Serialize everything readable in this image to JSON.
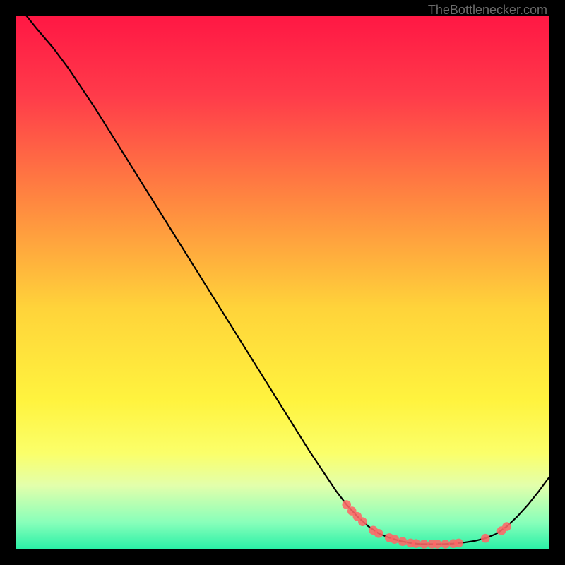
{
  "attribution": "TheBottlenecker.com",
  "chart_data": {
    "type": "line",
    "title": "",
    "xlabel": "",
    "ylabel": "",
    "xlim": [
      0,
      100
    ],
    "ylim": [
      0,
      100
    ],
    "gradient_stops": [
      {
        "offset": 0.0,
        "color": "#ff1744"
      },
      {
        "offset": 0.15,
        "color": "#ff3b4a"
      },
      {
        "offset": 0.35,
        "color": "#ff8840"
      },
      {
        "offset": 0.55,
        "color": "#ffd43a"
      },
      {
        "offset": 0.72,
        "color": "#fff33e"
      },
      {
        "offset": 0.82,
        "color": "#fbff6a"
      },
      {
        "offset": 0.88,
        "color": "#e3ffab"
      },
      {
        "offset": 0.95,
        "color": "#87ffba"
      },
      {
        "offset": 1.0,
        "color": "#28f0a6"
      }
    ],
    "series": [
      {
        "name": "bottleneck-curve",
        "color": "#000000",
        "points": [
          {
            "x": 2.0,
            "y": 100.0
          },
          {
            "x": 4.0,
            "y": 97.5
          },
          {
            "x": 7.0,
            "y": 94.0
          },
          {
            "x": 10.0,
            "y": 90.0
          },
          {
            "x": 15.0,
            "y": 82.5
          },
          {
            "x": 20.0,
            "y": 74.5
          },
          {
            "x": 25.0,
            "y": 66.5
          },
          {
            "x": 30.0,
            "y": 58.5
          },
          {
            "x": 35.0,
            "y": 50.5
          },
          {
            "x": 40.0,
            "y": 42.5
          },
          {
            "x": 45.0,
            "y": 34.5
          },
          {
            "x": 50.0,
            "y": 26.5
          },
          {
            "x": 55.0,
            "y": 18.5
          },
          {
            "x": 60.0,
            "y": 11.0
          },
          {
            "x": 62.0,
            "y": 8.4
          },
          {
            "x": 64.0,
            "y": 6.2
          },
          {
            "x": 66.0,
            "y": 4.4
          },
          {
            "x": 68.0,
            "y": 3.0
          },
          {
            "x": 70.0,
            "y": 2.2
          },
          {
            "x": 72.0,
            "y": 1.6
          },
          {
            "x": 74.0,
            "y": 1.2
          },
          {
            "x": 76.0,
            "y": 1.0
          },
          {
            "x": 78.0,
            "y": 1.0
          },
          {
            "x": 80.0,
            "y": 1.0
          },
          {
            "x": 82.0,
            "y": 1.1
          },
          {
            "x": 84.0,
            "y": 1.3
          },
          {
            "x": 86.0,
            "y": 1.6
          },
          {
            "x": 88.0,
            "y": 2.1
          },
          {
            "x": 90.0,
            "y": 2.9
          },
          {
            "x": 92.0,
            "y": 4.3
          },
          {
            "x": 94.0,
            "y": 6.2
          },
          {
            "x": 96.0,
            "y": 8.4
          },
          {
            "x": 98.0,
            "y": 10.9
          },
          {
            "x": 100.0,
            "y": 13.6
          }
        ]
      },
      {
        "name": "highlight-dots",
        "color": "#ff6666",
        "points": [
          {
            "x": 62.0,
            "y": 8.4
          },
          {
            "x": 63.0,
            "y": 7.2
          },
          {
            "x": 64.0,
            "y": 6.2
          },
          {
            "x": 65.0,
            "y": 5.2
          },
          {
            "x": 67.0,
            "y": 3.6
          },
          {
            "x": 68.0,
            "y": 3.0
          },
          {
            "x": 70.0,
            "y": 2.2
          },
          {
            "x": 71.0,
            "y": 1.9
          },
          {
            "x": 72.5,
            "y": 1.5
          },
          {
            "x": 74.0,
            "y": 1.2
          },
          {
            "x": 75.0,
            "y": 1.1
          },
          {
            "x": 76.5,
            "y": 1.0
          },
          {
            "x": 78.0,
            "y": 1.0
          },
          {
            "x": 79.0,
            "y": 1.0
          },
          {
            "x": 80.5,
            "y": 1.0
          },
          {
            "x": 82.0,
            "y": 1.1
          },
          {
            "x": 83.0,
            "y": 1.2
          },
          {
            "x": 88.0,
            "y": 2.1
          },
          {
            "x": 91.0,
            "y": 3.5
          },
          {
            "x": 92.0,
            "y": 4.3
          }
        ]
      }
    ]
  }
}
